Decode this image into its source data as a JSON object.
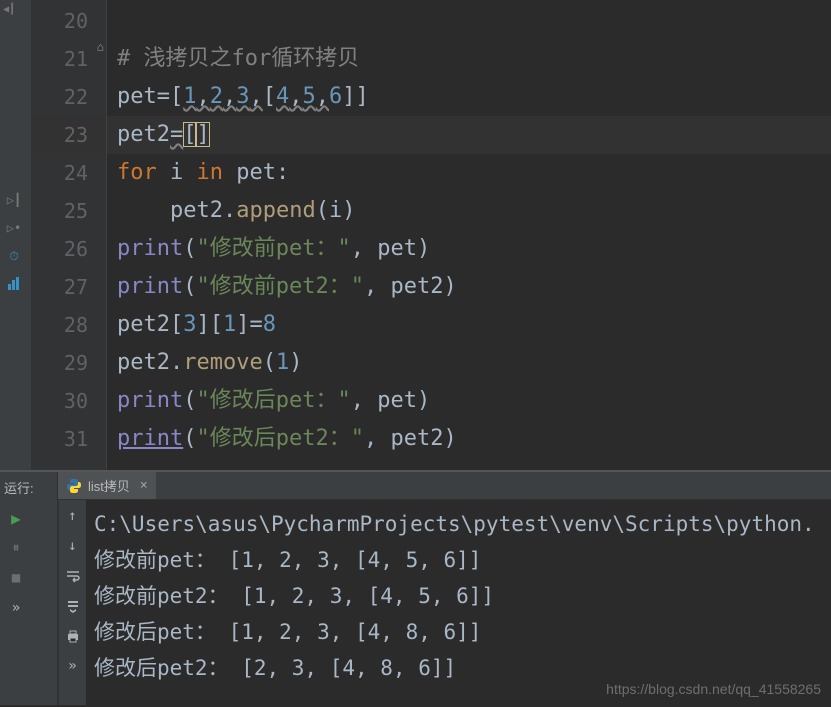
{
  "lines": [
    {
      "num": "20",
      "code": [
        {
          "t": " ",
          "c": "ident"
        }
      ]
    },
    {
      "num": "21",
      "code": [
        {
          "t": "# 浅拷贝之for循环拷贝",
          "c": "comment"
        }
      ]
    },
    {
      "num": "22",
      "code": [
        {
          "t": "pet",
          "c": "ident"
        },
        {
          "t": "=[",
          "c": "punct"
        },
        {
          "t": "1",
          "c": "num",
          "w": true
        },
        {
          "t": ",",
          "c": "punct",
          "w": true
        },
        {
          "t": "2",
          "c": "num",
          "w": true
        },
        {
          "t": ",",
          "c": "punct",
          "w": true
        },
        {
          "t": "3",
          "c": "num",
          "w": true
        },
        {
          "t": ",",
          "c": "punct",
          "w": true
        },
        {
          "t": "[",
          "c": "punct"
        },
        {
          "t": "4",
          "c": "num",
          "w": true
        },
        {
          "t": ",",
          "c": "punct",
          "w": true
        },
        {
          "t": "5",
          "c": "num",
          "w": true
        },
        {
          "t": ",",
          "c": "punct",
          "w": true
        },
        {
          "t": "6",
          "c": "num"
        },
        {
          "t": "]]",
          "c": "punct"
        }
      ]
    },
    {
      "num": "23",
      "hl": true,
      "code": [
        {
          "t": "pet2",
          "c": "ident"
        },
        {
          "t": "=",
          "c": "punct",
          "w": true
        },
        {
          "t": "[",
          "c": "punct",
          "br": true
        },
        {
          "t": "]",
          "c": "punct",
          "br": true
        }
      ]
    },
    {
      "num": "24",
      "code": [
        {
          "t": "for ",
          "c": "kw"
        },
        {
          "t": "i ",
          "c": "ident"
        },
        {
          "t": "in ",
          "c": "kw"
        },
        {
          "t": "pet:",
          "c": "ident"
        }
      ]
    },
    {
      "num": "25",
      "code": [
        {
          "t": "    pet2.",
          "c": "ident"
        },
        {
          "t": "append",
          "c": "method"
        },
        {
          "t": "(i)",
          "c": "ident"
        }
      ]
    },
    {
      "num": "26",
      "code": [
        {
          "t": "print",
          "c": "builtin"
        },
        {
          "t": "(",
          "c": "punct"
        },
        {
          "t": "\"修改前pet：\"",
          "c": "str"
        },
        {
          "t": ", ",
          "c": "punct"
        },
        {
          "t": "pet)",
          "c": "ident"
        }
      ]
    },
    {
      "num": "27",
      "code": [
        {
          "t": "print",
          "c": "builtin"
        },
        {
          "t": "(",
          "c": "punct"
        },
        {
          "t": "\"修改前pet2：\"",
          "c": "str"
        },
        {
          "t": ", ",
          "c": "punct"
        },
        {
          "t": "pet2)",
          "c": "ident"
        }
      ]
    },
    {
      "num": "28",
      "code": [
        {
          "t": "pet2[",
          "c": "ident"
        },
        {
          "t": "3",
          "c": "num"
        },
        {
          "t": "][",
          "c": "ident"
        },
        {
          "t": "1",
          "c": "num"
        },
        {
          "t": "]=",
          "c": "ident"
        },
        {
          "t": "8",
          "c": "num"
        }
      ]
    },
    {
      "num": "29",
      "code": [
        {
          "t": "pet2.",
          "c": "ident"
        },
        {
          "t": "remove",
          "c": "method"
        },
        {
          "t": "(",
          "c": "punct"
        },
        {
          "t": "1",
          "c": "num"
        },
        {
          "t": ")",
          "c": "punct"
        }
      ]
    },
    {
      "num": "30",
      "code": [
        {
          "t": "print",
          "c": "builtin"
        },
        {
          "t": "(",
          "c": "punct"
        },
        {
          "t": "\"修改后pet：\"",
          "c": "str"
        },
        {
          "t": ", ",
          "c": "punct"
        },
        {
          "t": "pet)",
          "c": "ident"
        }
      ]
    },
    {
      "num": "31",
      "code": [
        {
          "t": "print",
          "c": "builtin",
          "ul": true
        },
        {
          "t": "(",
          "c": "punct"
        },
        {
          "t": "\"修改后pet2：\"",
          "c": "str"
        },
        {
          "t": ", ",
          "c": "punct"
        },
        {
          "t": "pet2)",
          "c": "ident"
        }
      ]
    }
  ],
  "run_label": "运行:",
  "tab_name": "list拷贝",
  "output": [
    "C:\\Users\\asus\\PycharmProjects\\pytest\\venv\\Scripts\\python.",
    "修改前pet： [1, 2, 3, [4, 5, 6]]",
    "修改前pet2： [1, 2, 3, [4, 5, 6]]",
    "修改后pet： [1, 2, 3, [4, 8, 6]]",
    "修改后pet2： [2, 3, [4, 8, 6]]"
  ],
  "watermark": "https://blog.csdn.net/qq_41558265"
}
